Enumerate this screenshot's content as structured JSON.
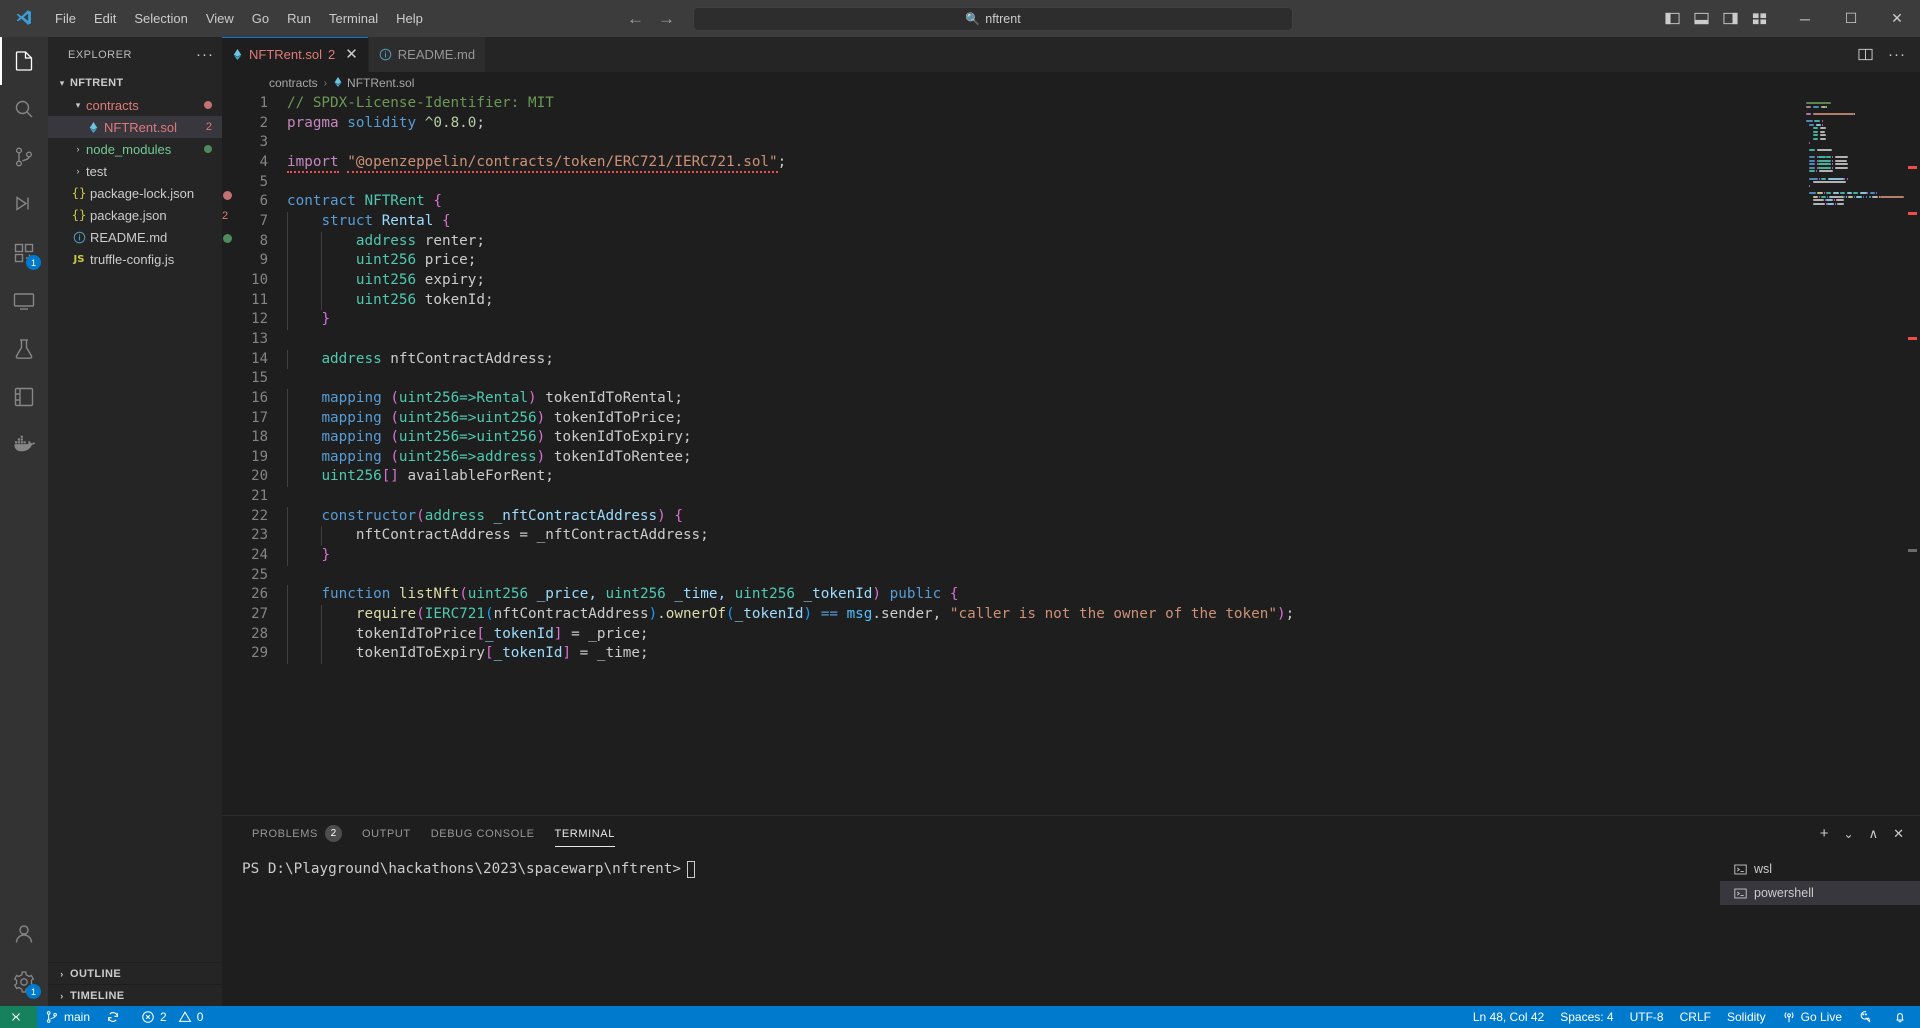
{
  "titlebar": {
    "menus": [
      "File",
      "Edit",
      "Selection",
      "View",
      "Go",
      "Run",
      "Terminal",
      "Help"
    ],
    "search_value": "nftrent",
    "back_arrow": "←",
    "forward_arrow": "→",
    "minimize": "─",
    "maximize": "☐",
    "close": "✕"
  },
  "activitybar": {
    "items": [
      {
        "name": "explorer",
        "badge": ""
      },
      {
        "name": "search",
        "badge": ""
      },
      {
        "name": "source-control",
        "badge": ""
      },
      {
        "name": "run-and-debug",
        "badge": ""
      },
      {
        "name": "extensions",
        "badge": "1"
      },
      {
        "name": "remote-explorer",
        "badge": ""
      },
      {
        "name": "testing",
        "badge": ""
      },
      {
        "name": "notebook",
        "badge": ""
      },
      {
        "name": "docker",
        "badge": ""
      }
    ],
    "bottom": [
      {
        "name": "accounts",
        "badge": ""
      },
      {
        "name": "settings",
        "badge": "1"
      }
    ]
  },
  "sidebar": {
    "title": "EXPLORER",
    "more_actions": "···",
    "root": "NFTRENT",
    "items": [
      {
        "label": "contracts",
        "icon": "folder",
        "twist": "⌄",
        "indent": 2,
        "color": "#e07a7a",
        "badge": "",
        "dot": "#c27272"
      },
      {
        "label": "NFTRent.sol",
        "icon": "solidity",
        "twist": "",
        "indent": 3,
        "color": "#e07a7a",
        "badge": "2",
        "dot": "",
        "selected": true
      },
      {
        "label": "node_modules",
        "icon": "folder",
        "twist": "›",
        "indent": 2,
        "color": "#73c991",
        "badge": "",
        "dot": "#587c0c"
      },
      {
        "label": "test",
        "icon": "folder",
        "twist": "›",
        "indent": 2,
        "color": "#cccccc",
        "badge": "",
        "dot": ""
      },
      {
        "label": "package-lock.json",
        "icon": "json",
        "twist": "",
        "indent": 2,
        "color": "#cccccc",
        "badge": "",
        "dot": ""
      },
      {
        "label": "package.json",
        "icon": "json",
        "twist": "",
        "indent": 2,
        "color": "#cccccc",
        "badge": "",
        "dot": ""
      },
      {
        "label": "README.md",
        "icon": "info",
        "twist": "",
        "indent": 2,
        "color": "#cccccc",
        "badge": "",
        "dot": ""
      },
      {
        "label": "truffle-config.js",
        "icon": "js",
        "twist": "",
        "indent": 2,
        "color": "#cccccc",
        "badge": "",
        "dot": ""
      }
    ],
    "sections": [
      {
        "label": "OUTLINE",
        "twist": "›"
      },
      {
        "label": "TIMELINE",
        "twist": "›"
      }
    ]
  },
  "editor": {
    "tabs": [
      {
        "label": "NFTRent.sol",
        "count": "2",
        "icon": "solidity",
        "active": true,
        "close": "✕"
      },
      {
        "label": "README.md",
        "count": "",
        "icon": "info",
        "active": false,
        "close": ""
      }
    ],
    "breadcrumb": [
      {
        "label": "contracts",
        "icon": ""
      },
      {
        "label": "NFTRent.sol",
        "icon": "solidity"
      }
    ],
    "breadcrumb_sep": "›",
    "lines": [
      {
        "n": 1,
        "segs": [
          {
            "t": "// SPDX-License-Identifier: MIT",
            "c": "#6a9955"
          }
        ]
      },
      {
        "n": 2,
        "segs": [
          {
            "t": "pragma",
            "c": "#c586c0"
          },
          {
            "t": " ",
            "c": "#cccccc"
          },
          {
            "t": "solidity",
            "c": "#569cd6"
          },
          {
            "t": " ",
            "c": "#cccccc"
          },
          {
            "t": "^0.8.0",
            "c": "#b5cea8"
          },
          {
            "t": ";",
            "c": "#cccccc"
          }
        ]
      },
      {
        "n": 3,
        "segs": []
      },
      {
        "n": 4,
        "segs": [
          {
            "t": "import",
            "c": "#c586c0",
            "sq": true
          },
          {
            "t": " ",
            "c": "#cccccc"
          },
          {
            "t": "\"@openzeppelin/contracts/token/ERC721/IERC721.sol\"",
            "c": "#ce9178",
            "sq": true
          },
          {
            "t": ";",
            "c": "#cccccc"
          }
        ]
      },
      {
        "n": 5,
        "segs": []
      },
      {
        "n": 6,
        "segs": [
          {
            "t": "contract",
            "c": "#569cd6"
          },
          {
            "t": " ",
            "c": "#cccccc"
          },
          {
            "t": "NFTRent",
            "c": "#4ec9b0"
          },
          {
            "t": " ",
            "c": "#cccccc"
          },
          {
            "t": "{",
            "c": "#da70d6"
          }
        ]
      },
      {
        "n": 7,
        "segs": [
          {
            "t": "    ",
            "c": "#cccccc"
          },
          {
            "t": "struct",
            "c": "#569cd6"
          },
          {
            "t": " ",
            "c": "#cccccc"
          },
          {
            "t": "Rental",
            "c": "#9cdcfe"
          },
          {
            "t": " ",
            "c": "#cccccc"
          },
          {
            "t": "{",
            "c": "#da70d6"
          }
        ]
      },
      {
        "n": 8,
        "segs": [
          {
            "t": "        ",
            "c": "#cccccc"
          },
          {
            "t": "address",
            "c": "#4ec9b0"
          },
          {
            "t": " renter;",
            "c": "#cccccc"
          }
        ]
      },
      {
        "n": 9,
        "segs": [
          {
            "t": "        ",
            "c": "#cccccc"
          },
          {
            "t": "uint256",
            "c": "#4ec9b0"
          },
          {
            "t": " price;",
            "c": "#cccccc"
          }
        ]
      },
      {
        "n": 10,
        "segs": [
          {
            "t": "        ",
            "c": "#cccccc"
          },
          {
            "t": "uint256",
            "c": "#4ec9b0"
          },
          {
            "t": " expiry;",
            "c": "#cccccc"
          }
        ]
      },
      {
        "n": 11,
        "segs": [
          {
            "t": "        ",
            "c": "#cccccc"
          },
          {
            "t": "uint256",
            "c": "#4ec9b0"
          },
          {
            "t": " tokenId;",
            "c": "#cccccc"
          }
        ]
      },
      {
        "n": 12,
        "segs": [
          {
            "t": "    ",
            "c": "#cccccc"
          },
          {
            "t": "}",
            "c": "#da70d6"
          }
        ]
      },
      {
        "n": 13,
        "segs": []
      },
      {
        "n": 14,
        "segs": [
          {
            "t": "    ",
            "c": "#cccccc"
          },
          {
            "t": "address",
            "c": "#4ec9b0"
          },
          {
            "t": " nftContractAddress;",
            "c": "#cccccc"
          }
        ]
      },
      {
        "n": 15,
        "segs": []
      },
      {
        "n": 16,
        "segs": [
          {
            "t": "    ",
            "c": "#cccccc"
          },
          {
            "t": "mapping",
            "c": "#569cd6"
          },
          {
            "t": " ",
            "c": "#cccccc"
          },
          {
            "t": "(",
            "c": "#da70d6"
          },
          {
            "t": "uint256=>",
            "c": "#4ec9b0"
          },
          {
            "t": "Rental",
            "c": "#4ec9b0"
          },
          {
            "t": ")",
            "c": "#da70d6"
          },
          {
            "t": " tokenIdToRental;",
            "c": "#cccccc"
          }
        ]
      },
      {
        "n": 17,
        "segs": [
          {
            "t": "    ",
            "c": "#cccccc"
          },
          {
            "t": "mapping",
            "c": "#569cd6"
          },
          {
            "t": " ",
            "c": "#cccccc"
          },
          {
            "t": "(",
            "c": "#da70d6"
          },
          {
            "t": "uint256=>uint256",
            "c": "#4ec9b0"
          },
          {
            "t": ")",
            "c": "#da70d6"
          },
          {
            "t": " tokenIdToPrice;",
            "c": "#cccccc"
          }
        ]
      },
      {
        "n": 18,
        "segs": [
          {
            "t": "    ",
            "c": "#cccccc"
          },
          {
            "t": "mapping",
            "c": "#569cd6"
          },
          {
            "t": " ",
            "c": "#cccccc"
          },
          {
            "t": "(",
            "c": "#da70d6"
          },
          {
            "t": "uint256=>uint256",
            "c": "#4ec9b0"
          },
          {
            "t": ")",
            "c": "#da70d6"
          },
          {
            "t": " tokenIdToExpiry;",
            "c": "#cccccc"
          }
        ]
      },
      {
        "n": 19,
        "segs": [
          {
            "t": "    ",
            "c": "#cccccc"
          },
          {
            "t": "mapping",
            "c": "#569cd6"
          },
          {
            "t": " ",
            "c": "#cccccc"
          },
          {
            "t": "(",
            "c": "#da70d6"
          },
          {
            "t": "uint256=>address",
            "c": "#4ec9b0"
          },
          {
            "t": ")",
            "c": "#da70d6"
          },
          {
            "t": " tokenIdToRentee;",
            "c": "#cccccc"
          }
        ]
      },
      {
        "n": 20,
        "segs": [
          {
            "t": "    ",
            "c": "#cccccc"
          },
          {
            "t": "uint256",
            "c": "#4ec9b0"
          },
          {
            "t": "[]",
            "c": "#da70d6"
          },
          {
            "t": " availableForRent;",
            "c": "#cccccc"
          }
        ]
      },
      {
        "n": 21,
        "segs": []
      },
      {
        "n": 22,
        "segs": [
          {
            "t": "    ",
            "c": "#cccccc"
          },
          {
            "t": "constructor",
            "c": "#569cd6"
          },
          {
            "t": "(",
            "c": "#da70d6"
          },
          {
            "t": "address",
            "c": "#4ec9b0"
          },
          {
            "t": " _nftContractAddress",
            "c": "#9cdcfe"
          },
          {
            "t": ")",
            "c": "#da70d6"
          },
          {
            "t": " ",
            "c": "#cccccc"
          },
          {
            "t": "{",
            "c": "#da70d6"
          }
        ]
      },
      {
        "n": 23,
        "segs": [
          {
            "t": "        nftContractAddress = _nftContractAddress;",
            "c": "#cccccc"
          }
        ]
      },
      {
        "n": 24,
        "segs": [
          {
            "t": "    ",
            "c": "#cccccc"
          },
          {
            "t": "}",
            "c": "#da70d6"
          }
        ]
      },
      {
        "n": 25,
        "segs": []
      },
      {
        "n": 26,
        "segs": [
          {
            "t": "    ",
            "c": "#cccccc"
          },
          {
            "t": "function",
            "c": "#569cd6"
          },
          {
            "t": " ",
            "c": "#cccccc"
          },
          {
            "t": "listNft",
            "c": "#dcdcaa"
          },
          {
            "t": "(",
            "c": "#da70d6"
          },
          {
            "t": "uint256",
            "c": "#4ec9b0"
          },
          {
            "t": " _price, ",
            "c": "#9cdcfe"
          },
          {
            "t": "uint256",
            "c": "#4ec9b0"
          },
          {
            "t": " _time, ",
            "c": "#9cdcfe"
          },
          {
            "t": "uint256",
            "c": "#4ec9b0"
          },
          {
            "t": " _tokenId",
            "c": "#9cdcfe"
          },
          {
            "t": ")",
            "c": "#da70d6"
          },
          {
            "t": " ",
            "c": "#cccccc"
          },
          {
            "t": "public",
            "c": "#569cd6"
          },
          {
            "t": " ",
            "c": "#cccccc"
          },
          {
            "t": "{",
            "c": "#da70d6"
          }
        ]
      },
      {
        "n": 27,
        "segs": [
          {
            "t": "        ",
            "c": "#cccccc"
          },
          {
            "t": "require",
            "c": "#dcdcaa"
          },
          {
            "t": "(",
            "c": "#da70d6"
          },
          {
            "t": "IERC721",
            "c": "#4ec9b0"
          },
          {
            "t": "(",
            "c": "#179fff"
          },
          {
            "t": "nftContractAddress",
            "c": "#cccccc"
          },
          {
            "t": ")",
            "c": "#179fff"
          },
          {
            "t": ".",
            "c": "#cccccc"
          },
          {
            "t": "ownerOf",
            "c": "#dcdcaa"
          },
          {
            "t": "(",
            "c": "#179fff"
          },
          {
            "t": "_tokenId",
            "c": "#9cdcfe"
          },
          {
            "t": ")",
            "c": "#179fff"
          },
          {
            "t": " ",
            "c": "#cccccc"
          },
          {
            "t": "==",
            "c": "#569cd6"
          },
          {
            "t": " ",
            "c": "#cccccc"
          },
          {
            "t": "msg",
            "c": "#4fc1ff"
          },
          {
            "t": ".sender",
            "c": "#cccccc"
          },
          {
            "t": ", ",
            "c": "#cccccc"
          },
          {
            "t": "\"caller is not the owner of the token\"",
            "c": "#ce9178"
          },
          {
            "t": ")",
            "c": "#da70d6"
          },
          {
            "t": ";",
            "c": "#cccccc"
          }
        ]
      },
      {
        "n": 28,
        "segs": [
          {
            "t": "        tokenIdToPrice",
            "c": "#cccccc"
          },
          {
            "t": "[",
            "c": "#da70d6"
          },
          {
            "t": "_tokenId",
            "c": "#9cdcfe"
          },
          {
            "t": "]",
            "c": "#da70d6"
          },
          {
            "t": " = _price;",
            "c": "#cccccc"
          }
        ]
      },
      {
        "n": 29,
        "segs": [
          {
            "t": "        tokenIdToExpiry",
            "c": "#cccccc"
          },
          {
            "t": "[",
            "c": "#da70d6"
          },
          {
            "t": "_tokenId",
            "c": "#9cdcfe"
          },
          {
            "t": "]",
            "c": "#da70d6"
          },
          {
            "t": " = _time;",
            "c": "#cccccc"
          }
        ]
      }
    ]
  },
  "panel": {
    "tabs": [
      {
        "label": "PROBLEMS",
        "count": "2",
        "active": false
      },
      {
        "label": "OUTPUT",
        "count": "",
        "active": false
      },
      {
        "label": "DEBUG CONSOLE",
        "count": "",
        "active": false
      },
      {
        "label": "TERMINAL",
        "count": "",
        "active": true
      }
    ],
    "actions": {
      "add": "+",
      "chevron": "⌄",
      "split": "⎓",
      "maximize": "∧",
      "close": "✕"
    },
    "terminal_text": "PS D:\\Playground\\hackathons\\2023\\spacewarp\\nftrent>",
    "terminal_instances": [
      {
        "label": "wsl",
        "active": false
      },
      {
        "label": "powershell",
        "active": true
      }
    ]
  },
  "statusbar": {
    "remote_label": "",
    "branch": "main",
    "sync": "",
    "errors": "2",
    "warnings": "0",
    "position": "Ln 48, Col 42",
    "spaces": "Spaces: 4",
    "encoding": "UTF-8",
    "eol": "CRLF",
    "language": "Solidity",
    "golive": "Go Live",
    "feedback": "",
    "bell": ""
  },
  "colors": {
    "accent": "#007acc",
    "remote_green": "#16825d",
    "error_red": "#f14c4c",
    "modified_orange": "#e2c08d",
    "tab_active_text": "#e07a7a"
  }
}
